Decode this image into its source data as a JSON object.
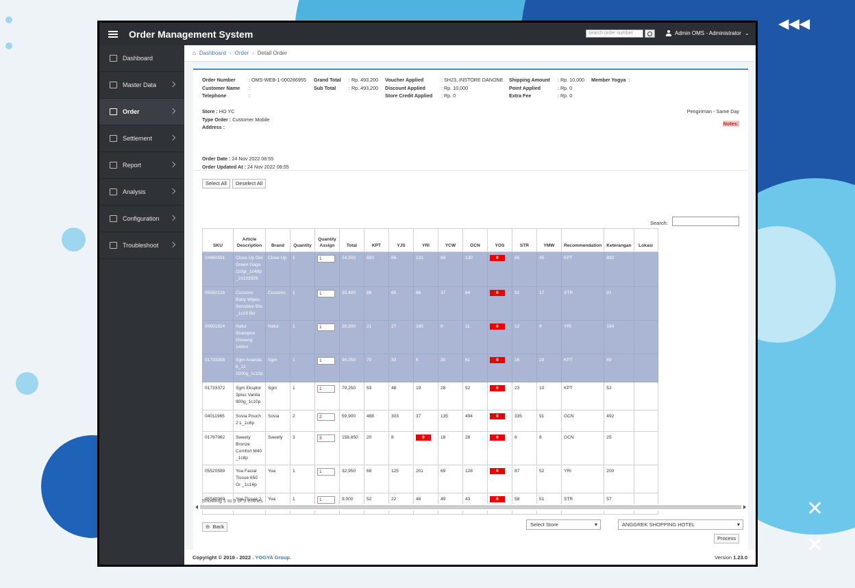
{
  "colors": {
    "accent": "#3d8fc6",
    "topbar": "#2b2e33",
    "sidebar": "#2f3237",
    "selected_row": "#aab6d3",
    "zero_badge": "#ee0000"
  },
  "header": {
    "title": "Order Management System",
    "search_placeholder": "search order number",
    "user": "Admin OMS - Administrator"
  },
  "sidebar": {
    "items": [
      {
        "label": "Dashboard",
        "icon": "home-icon"
      },
      {
        "label": "Master Data",
        "icon": "bookmark-icon"
      },
      {
        "label": "Order",
        "icon": "clipboard-check-icon"
      },
      {
        "label": "Settlement",
        "icon": "books-icon"
      },
      {
        "label": "Report",
        "icon": "list-icon"
      },
      {
        "label": "Analysis",
        "icon": "area-chart-icon"
      },
      {
        "label": "Configuration",
        "icon": "sliders-icon"
      },
      {
        "label": "Troubleshoot",
        "icon": "tools-icon"
      }
    ]
  },
  "breadcrumb": {
    "home": "Dashboard",
    "order": "Order",
    "current": "Detail Order"
  },
  "order": {
    "number_label": "Order Number",
    "number": ": OMS-WEB-1-000286955",
    "customer_label": "Customer Name",
    "customer": ":",
    "telephone_label": "Telephone",
    "telephone": ":",
    "grand_total_label": "Grand Total",
    "grand_total": ": Rp. 493,200",
    "sub_total_label": "Sub Total",
    "sub_total": ": Rp. 493,200",
    "voucher_label": "Voucher Applied",
    "voucher": ": SH23, INSTORE DANONE",
    "discount_label": "Discount Applied",
    "discount": ": Rp. 10,000",
    "credit_label": "Store Credit Applied",
    "credit": ": Rp. 0",
    "shipping_label": "Shipping Amount",
    "shipping": ": Rp. 10,000",
    "point_label": "Point Applied",
    "point": ": Rp. 0",
    "extra_label": "Extra Fee",
    "extra": ": Rp. 0",
    "member_label": "Member Yogya",
    "member": ":",
    "store_label": "Store :",
    "store": "HO YC",
    "type_label": "Type Order :",
    "type": "Customer Mobile",
    "address_label": "Address :",
    "address": "",
    "shipping_method": "Pengiriman - Same Day",
    "notes_label": "Notes:",
    "date_label": "Order Date :",
    "date": "24 Nov 2022 08:55",
    "updated_label": "Order Updated At :",
    "updated": "24 Nov 2022 08:55"
  },
  "buttons": {
    "select_all": "Select All",
    "deselect_all": "Deselect All",
    "back": "Back",
    "process": "Process"
  },
  "table": {
    "search_label": "Search:",
    "columns": [
      "SKU",
      "Article Description",
      "Brand",
      "Quantity",
      "Quantity Assign",
      "Total",
      "KPT",
      "YJS",
      "YRI",
      "YCW",
      "GCN",
      "YOS",
      "STR",
      "YMW",
      "Recommendation",
      "Keterangan",
      "Lokasi"
    ],
    "rows": [
      {
        "selected": true,
        "cells": [
          "04960591",
          "Close Up Gel Green Gaga 110gr_1c48p _21133329",
          "Close Up",
          "1",
          "1",
          "14,300",
          "893",
          "66",
          "131",
          "68",
          "130",
          "0",
          "65",
          "45",
          "KPT",
          "892",
          ""
        ]
      },
      {
        "selected": true,
        "cells": [
          "05592128",
          "Cussons Baby Wipes Sensitive 50s _1c18 Bd",
          "Cussons",
          "1",
          "1",
          "20,400",
          "88",
          "65",
          "86",
          "37",
          "84",
          "0",
          "92",
          "17",
          "STR",
          "91",
          ""
        ]
      },
      {
        "selected": true,
        "cells": [
          "04501824",
          "Natur Shampoo Ginseng 140ml",
          "Natur",
          "1",
          "1",
          "28,300",
          "21",
          "27",
          "165",
          "9",
          "11",
          "0",
          "12",
          "9",
          "YRI",
          "164",
          ""
        ]
      },
      {
        "selected": true,
        "cells": [
          "01733358",
          "Sgm Ananda 6_12 1000g_1c10p",
          "Sgm",
          "1",
          "1",
          "90,250",
          "70",
          "33",
          "6",
          "30",
          "61",
          "0",
          "16",
          "28",
          "KPT",
          "69",
          ""
        ]
      },
      {
        "selected": false,
        "cells": [
          "01733372",
          "Sgm Eksplor 3plus Vanila 900g_1c10p",
          "Sgm",
          "1",
          "1",
          "79,250",
          "53",
          "48",
          "19",
          "28",
          "52",
          "0",
          "23",
          "10",
          "KPT",
          "52",
          ""
        ]
      },
      {
        "selected": false,
        "cells": [
          "04011965",
          "Sovia Pouch 2 L_1c6p",
          "Sovia",
          "2",
          "2",
          "59,900",
          "488",
          "303",
          "37",
          "135",
          "494",
          "0",
          "335",
          "91",
          "GCN",
          "492",
          ""
        ]
      },
      {
        "selected": false,
        "cells": [
          "01787962",
          "Sweety Bronze Comfort M40 _1c8p",
          "Sweety",
          "3",
          "3",
          "158,850",
          "20",
          "8",
          "0",
          "18",
          "28",
          "0",
          "6",
          "8",
          "GCN",
          "25",
          ""
        ]
      },
      {
        "selected": false,
        "cells": [
          "05520589",
          "Yoa Facial Tissue 650 Gr _1c16p",
          "Yoa",
          "1",
          "1",
          "32,950",
          "68",
          "125",
          "201",
          "69",
          "128",
          "0",
          "87",
          "52",
          "YRI",
          "200",
          ""
        ]
      },
      {
        "selected": false,
        "cells": [
          "05540969",
          "Yoa Tissue 2 Roll _1c48p",
          "Yoa",
          "1",
          "1",
          "9,000",
          "52",
          "22",
          "48",
          "49",
          "43",
          "0",
          "58",
          "51",
          "STR",
          "57",
          ""
        ]
      }
    ],
    "showing": "Showing 1 to 9 of 9 entries"
  },
  "selects": {
    "store_placeholder": "Select Store",
    "location": "ANGGREK SHOPPING HOTEL"
  },
  "footer": {
    "copyright": "Copyright © 2019 - 2022 .",
    "company": "YOGYA Group.",
    "version_label": "Version",
    "version": "1.23.0"
  }
}
